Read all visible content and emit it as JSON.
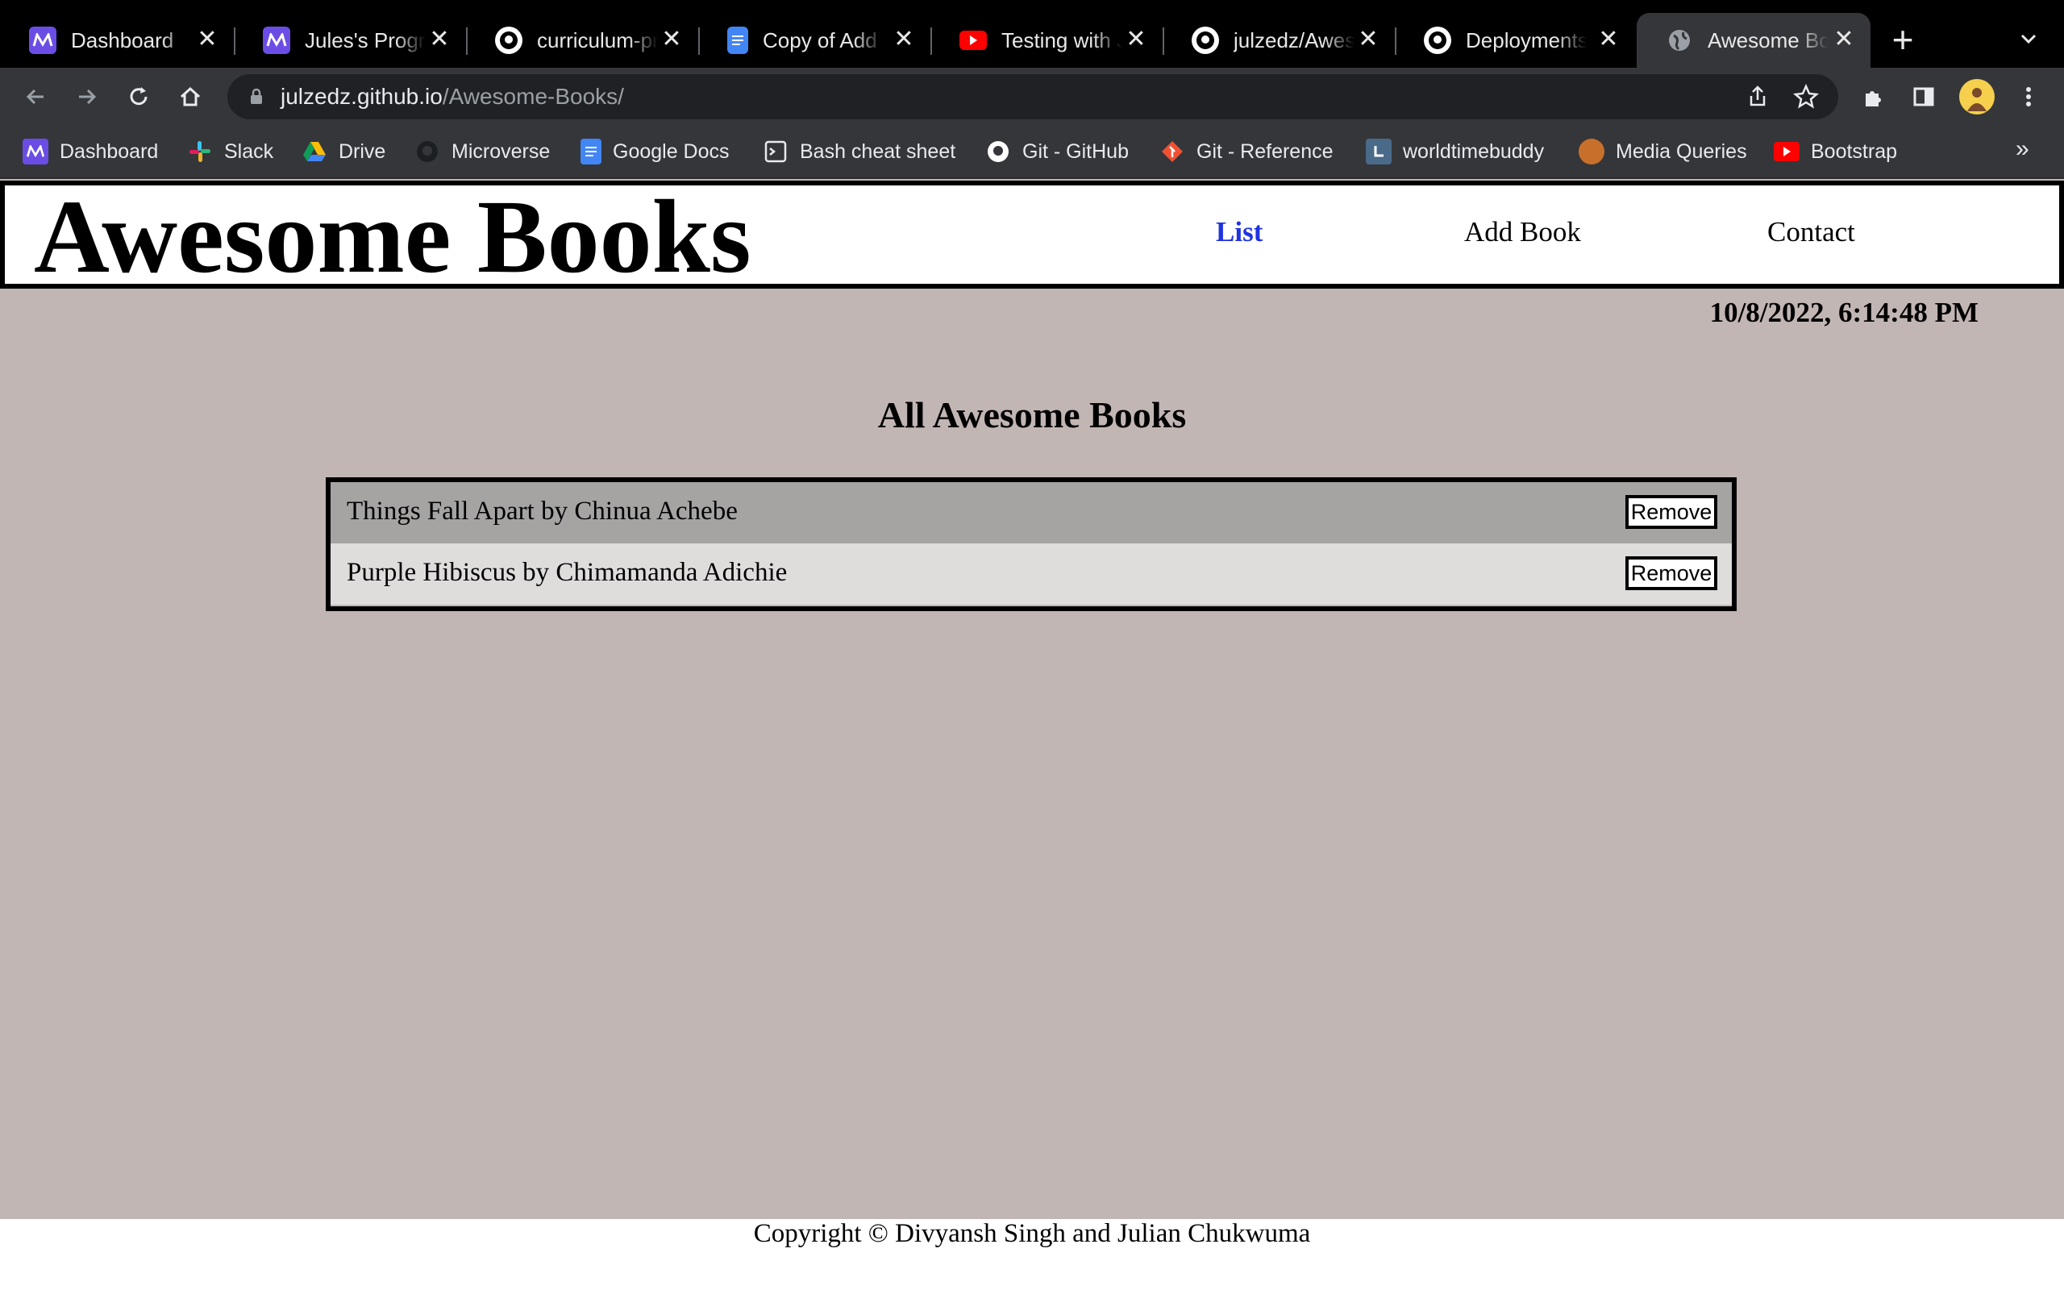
{
  "browser": {
    "tabs": [
      {
        "title": "Dashboard",
        "icon": "microverse-icon"
      },
      {
        "title": "Jules's Progress",
        "icon": "microverse-icon"
      },
      {
        "title": "curriculum-prep",
        "icon": "github-icon"
      },
      {
        "title": "Copy of Add a",
        "icon": "google-docs-icon"
      },
      {
        "title": "Testing with Je",
        "icon": "youtube-icon"
      },
      {
        "title": "julzedz/Awesome",
        "icon": "github-icon"
      },
      {
        "title": "Deployments",
        "icon": "github-icon"
      },
      {
        "title": "Awesome Boo",
        "icon": "globe-icon",
        "active": true
      }
    ],
    "url_host": "julzedz.github.io",
    "url_path": "/Awesome-Books/",
    "bookmarks": [
      {
        "label": "Dashboard",
        "icon": "microverse-icon"
      },
      {
        "label": "Slack",
        "icon": "slack-icon"
      },
      {
        "label": "Drive",
        "icon": "google-drive-icon"
      },
      {
        "label": "Microverse",
        "icon": "github-icon"
      },
      {
        "label": "Google Docs",
        "icon": "google-docs-icon"
      },
      {
        "label": "Bash cheat sheet",
        "icon": "terminal-icon"
      },
      {
        "label": "Git - GitHub",
        "icon": "github-icon"
      },
      {
        "label": "Git - Reference",
        "icon": "git-icon"
      },
      {
        "label": "worldtimebuddy",
        "icon": "worldtimebuddy-icon"
      },
      {
        "label": "Media Queries",
        "icon": "circle-icon"
      },
      {
        "label": "Bootstrap",
        "icon": "youtube-icon"
      }
    ],
    "more_bookmarks": "»"
  },
  "site": {
    "logo": "Awesome Books",
    "nav": {
      "list": "List",
      "add": "Add Book",
      "contact": "Contact"
    },
    "datetime": "10/8/2022, 6:14:48 PM",
    "section_title": "All Awesome Books",
    "books": [
      {
        "text": "Things Fall Apart by Chinua Achebe",
        "button": "Remove"
      },
      {
        "text": "Purple Hibiscus by Chimamanda Adichie",
        "button": "Remove"
      }
    ],
    "footer": "Copyright © Divyansh Singh and Julian Chukwuma"
  },
  "colors": {
    "page_bg": "#c2b6b5",
    "active_nav": "#1f33e0",
    "row_odd": "#a6a3a3",
    "row_even": "#dfdcdc"
  }
}
